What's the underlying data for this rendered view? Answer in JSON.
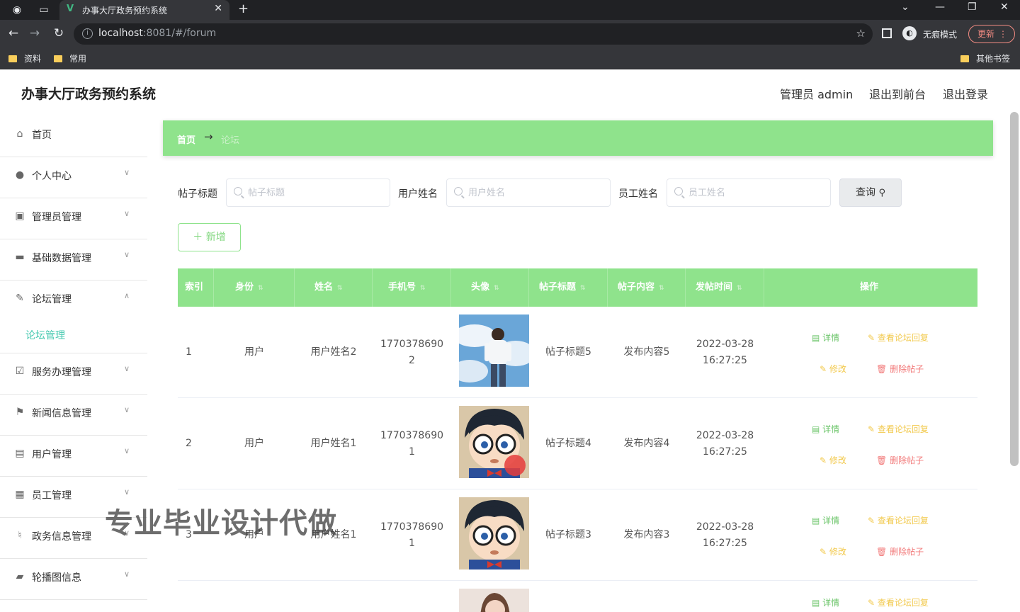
{
  "browser": {
    "tab_title": "办事大厅政务预约系统",
    "url_host": "localhost",
    "url_rest": ":8081/#/forum",
    "incognito_label": "无痕模式",
    "update_label": "更新",
    "bookmarks": [
      "资料",
      "常用"
    ],
    "other_bookmarks": "其他书签"
  },
  "header": {
    "title": "办事大厅政务预约系统",
    "admin_label": "管理员 admin",
    "back_front": "退出到前台",
    "logout": "退出登录"
  },
  "sidebar": {
    "items": [
      {
        "label": "首页",
        "icon": "home-icon"
      },
      {
        "label": "个人中心",
        "icon": "user-icon"
      },
      {
        "label": "管理员管理",
        "icon": "admin-icon"
      },
      {
        "label": "基础数据管理",
        "icon": "monitor-icon"
      },
      {
        "label": "论坛管理",
        "icon": "edit-icon"
      },
      {
        "label": "论坛管理",
        "icon": ""
      },
      {
        "label": "服务办理管理",
        "icon": "check-icon"
      },
      {
        "label": "新闻信息管理",
        "icon": "flag-icon"
      },
      {
        "label": "用户管理",
        "icon": "doc-icon"
      },
      {
        "label": "员工管理",
        "icon": "grid-icon"
      },
      {
        "label": "政务信息管理",
        "icon": "mic-icon"
      },
      {
        "label": "轮播图信息",
        "icon": "briefcase-icon"
      }
    ]
  },
  "breadcrumb": {
    "home": "首页",
    "separator": "→",
    "current": "论坛"
  },
  "search": {
    "fields": [
      {
        "label": "帖子标题",
        "placeholder": "帖子标题"
      },
      {
        "label": "用户姓名",
        "placeholder": "用户姓名"
      },
      {
        "label": "员工姓名",
        "placeholder": "员工姓名"
      }
    ],
    "query_label": "查询",
    "add_label": "新增"
  },
  "table": {
    "headers": [
      "索引",
      "身份",
      "姓名",
      "手机号",
      "头像",
      "帖子标题",
      "帖子内容",
      "发帖时间",
      "操作"
    ],
    "rows": [
      {
        "index": "1",
        "role": "用户",
        "name": "用户姓名2",
        "phone1": "1770378690",
        "phone2": "2",
        "title": "帖子标题5",
        "content": "发布内容5",
        "date": "2022-03-28",
        "time": "16:27:25",
        "avatar": "sky-boy"
      },
      {
        "index": "2",
        "role": "用户",
        "name": "用户姓名1",
        "phone1": "1770378690",
        "phone2": "1",
        "title": "帖子标题4",
        "content": "发布内容4",
        "date": "2022-03-28",
        "time": "16:27:25",
        "avatar": "cartoon-boy"
      },
      {
        "index": "3",
        "role": "用户",
        "name": "用户姓名1",
        "phone1": "1770378690",
        "phone2": "1",
        "title": "帖子标题3",
        "content": "发布内容3",
        "date": "2022-03-28",
        "time": "16:27:25",
        "avatar": "cartoon-boy"
      }
    ],
    "actions": {
      "detail": "详情",
      "reply": "查看论坛回复",
      "edit": "修改",
      "delete": "删除帖子"
    }
  },
  "watermark": "专业毕业设计代做",
  "colors": {
    "accent": "#8fe38c",
    "submenu_active": "#46c9b0",
    "danger": "#f27b7b",
    "warning": "#f2c94c"
  }
}
